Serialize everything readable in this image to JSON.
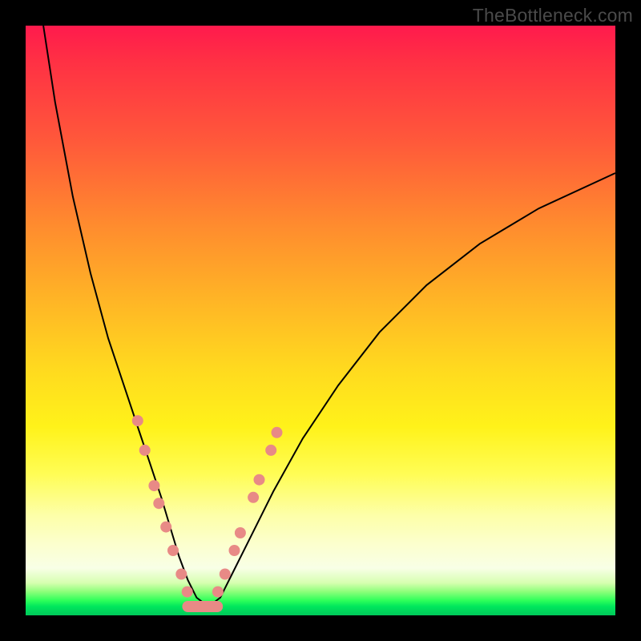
{
  "watermark": "TheBottleneck.com",
  "chart_data": {
    "type": "line",
    "title": "",
    "xlabel": "",
    "ylabel": "",
    "xlim": [
      0,
      100
    ],
    "ylim": [
      0,
      100
    ],
    "grid": false,
    "legend": false,
    "background_gradient": [
      "#ff1a4d",
      "#ff8c2e",
      "#fff21a",
      "#fcffce",
      "#00c95a"
    ],
    "series": [
      {
        "name": "bottleneck-curve",
        "color": "#000000",
        "x": [
          3,
          5,
          8,
          11,
          14,
          17,
          19,
          21,
          23,
          24.5,
          26,
          27.5,
          29,
          31,
          33,
          35,
          38,
          42,
          47,
          53,
          60,
          68,
          77,
          87,
          100
        ],
        "y": [
          100,
          87,
          71,
          58,
          47,
          38,
          32,
          26,
          20,
          15,
          10,
          6,
          3,
          1.5,
          3,
          7,
          13,
          21,
          30,
          39,
          48,
          56,
          63,
          69,
          75
        ]
      }
    ],
    "highlight_points_left": {
      "color": "#e88a86",
      "points": [
        {
          "x": 19.0,
          "y": 33
        },
        {
          "x": 20.2,
          "y": 28
        },
        {
          "x": 21.8,
          "y": 22
        },
        {
          "x": 22.6,
          "y": 19
        },
        {
          "x": 23.8,
          "y": 15
        },
        {
          "x": 25.0,
          "y": 11
        },
        {
          "x": 26.4,
          "y": 7
        },
        {
          "x": 27.4,
          "y": 4
        }
      ]
    },
    "highlight_points_right": {
      "color": "#e88a86",
      "points": [
        {
          "x": 32.6,
          "y": 4
        },
        {
          "x": 33.8,
          "y": 7
        },
        {
          "x": 35.4,
          "y": 11
        },
        {
          "x": 36.4,
          "y": 14
        },
        {
          "x": 38.6,
          "y": 20
        },
        {
          "x": 39.6,
          "y": 23
        },
        {
          "x": 41.6,
          "y": 28
        },
        {
          "x": 42.6,
          "y": 31
        }
      ]
    },
    "bottom_segment": {
      "color": "#e88a86",
      "x_start": 27.5,
      "x_end": 32.5,
      "y": 1.5
    }
  }
}
